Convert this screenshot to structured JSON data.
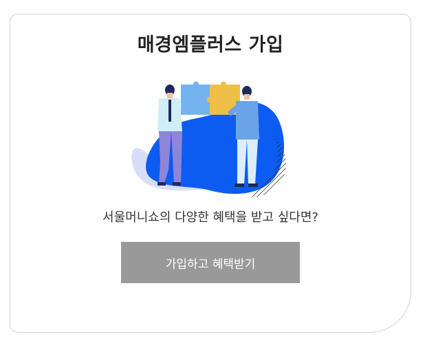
{
  "card": {
    "title": "매경엠플러스 가입",
    "tagline": "서울머니쇼의 다양한 혜택을 받고 싶다면?",
    "signup_button_label": "가입하고 혜택받기"
  },
  "illustration": {
    "icon": "puzzle-partners-illustration"
  },
  "colors": {
    "blob_blue": "#0d5cf2",
    "shadow_lavender": "#d7def7",
    "puzzle_blue": "#74b3ee",
    "puzzle_yellow": "#eec049",
    "button_gray": "#999999",
    "title_text": "#222222"
  }
}
